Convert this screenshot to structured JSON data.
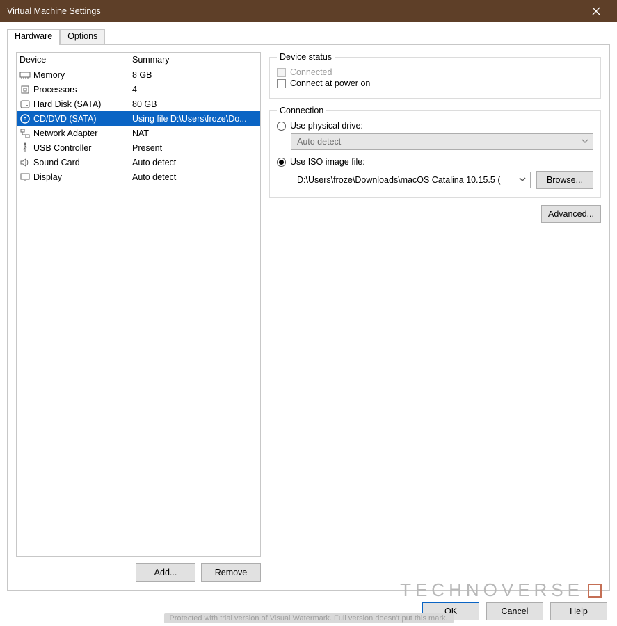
{
  "title": "Virtual Machine Settings",
  "tabs": {
    "hardware": "Hardware",
    "options": "Options",
    "active": "hardware"
  },
  "deviceList": {
    "headers": {
      "device": "Device",
      "summary": "Summary"
    },
    "selectedIndex": 3,
    "items": [
      {
        "name": "Memory",
        "summary": "8 GB",
        "icon": "memory-icon"
      },
      {
        "name": "Processors",
        "summary": "4",
        "icon": "cpu-icon"
      },
      {
        "name": "Hard Disk (SATA)",
        "summary": "80 GB",
        "icon": "disk-icon"
      },
      {
        "name": "CD/DVD (SATA)",
        "summary": "Using file D:\\Users\\froze\\Do...",
        "icon": "cd-icon"
      },
      {
        "name": "Network Adapter",
        "summary": "NAT",
        "icon": "network-icon"
      },
      {
        "name": "USB Controller",
        "summary": "Present",
        "icon": "usb-icon"
      },
      {
        "name": "Sound Card",
        "summary": "Auto detect",
        "icon": "sound-icon"
      },
      {
        "name": "Display",
        "summary": "Auto detect",
        "icon": "display-icon"
      }
    ]
  },
  "leftButtons": {
    "add": "Add...",
    "remove": "Remove"
  },
  "status": {
    "legend": "Device status",
    "connected": {
      "label": "Connected",
      "checked": false,
      "enabled": false
    },
    "connectAtPowerOn": {
      "label": "Connect at power on",
      "checked": false,
      "enabled": true
    }
  },
  "connection": {
    "legend": "Connection",
    "mode": "iso",
    "physical": {
      "label": "Use physical drive:",
      "dropdownValue": "Auto detect"
    },
    "iso": {
      "label": "Use ISO image file:",
      "path": "D:\\Users\\froze\\Downloads\\macOS Catalina 10.15.5 (",
      "browse": "Browse..."
    }
  },
  "advanced": "Advanced...",
  "bottom": {
    "ok": "OK",
    "cancel": "Cancel",
    "help": "Help"
  },
  "watermark": {
    "logo": "TECHNOVERSE",
    "bar": "Protected with trial version of Visual Watermark. Full version doesn't put this mark."
  }
}
